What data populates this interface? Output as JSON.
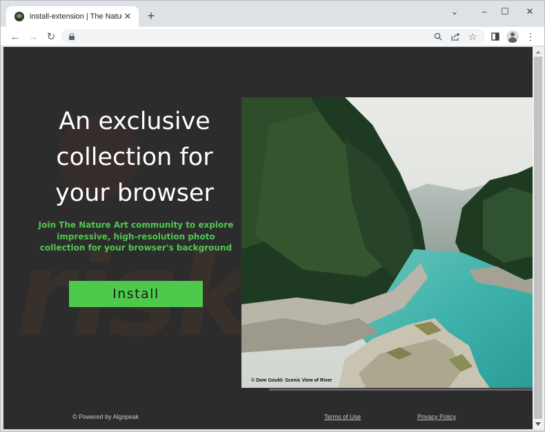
{
  "browser": {
    "tab_title": "install-extension | The Nature Art",
    "tab_close": "✕",
    "new_tab": "+",
    "window_controls": {
      "minimize": "−",
      "maximize": "☐",
      "close": "✕",
      "tab_search": "⌄"
    },
    "nav": {
      "back": "←",
      "forward": "→",
      "reload": "↻"
    },
    "address": "",
    "icons": [
      "search-icon",
      "share-icon",
      "bookmark-star-icon",
      "side-panel-icon",
      "profile-icon",
      "more-menu-icon"
    ]
  },
  "page": {
    "headline": "An exclusive collection for your browser",
    "subtext": "Join The Nature Art community to explore impressive, high-resolution photo collection for your browser's background",
    "install_label": "Install",
    "photo_credit": "© Dom Gould- Scenic View of River",
    "footer": {
      "powered_by": "© Powered by Algopeak",
      "terms": "Terms of Use",
      "privacy": "Privacy Policy"
    },
    "watermark": "risk.",
    "colors": {
      "background": "#2c2c2c",
      "accent_green": "#4dc94b",
      "subtext_green": "#4ec94e"
    }
  }
}
